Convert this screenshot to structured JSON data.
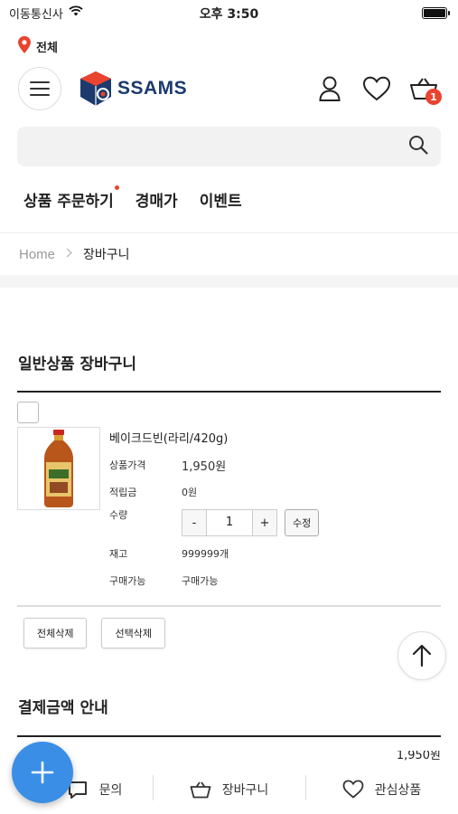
{
  "status_bar": {
    "carrier": "이동통신사",
    "time": "오후 3:50"
  },
  "location": {
    "label": "전체"
  },
  "header": {
    "logo_text": "SSAMS",
    "cart_count": "1"
  },
  "search": {
    "placeholder": "",
    "value": ""
  },
  "nav": {
    "items": [
      "상품 주문하기",
      "경매가",
      "이벤트"
    ]
  },
  "breadcrumb": {
    "home": "Home",
    "current": "장바구니"
  },
  "cart": {
    "title": "일반상품 장바구니",
    "item": {
      "name": "베이크드빈(라리/420g)",
      "price_label": "상품가격",
      "price": "1,950원",
      "points_label": "적립금",
      "points": "0원",
      "qty_label": "수량",
      "qty_minus": "-",
      "qty_value": "1",
      "qty_plus": "+",
      "qty_edit": "수정",
      "stock_label": "재고",
      "stock": "999999개",
      "available_label": "구매가능",
      "available": "구매가능"
    },
    "delete_all": "전체삭제",
    "delete_selected": "선택삭제"
  },
  "payment": {
    "title": "결제금액 안내",
    "amount": "1,950원"
  },
  "bottom_nav": {
    "inquiry": "문의",
    "cart": "장바구니",
    "wishlist": "관심상품"
  },
  "colors": {
    "brand_navy": "#1c3a6e",
    "accent_red": "#e8442f",
    "fab_blue": "#3a8ee6"
  }
}
